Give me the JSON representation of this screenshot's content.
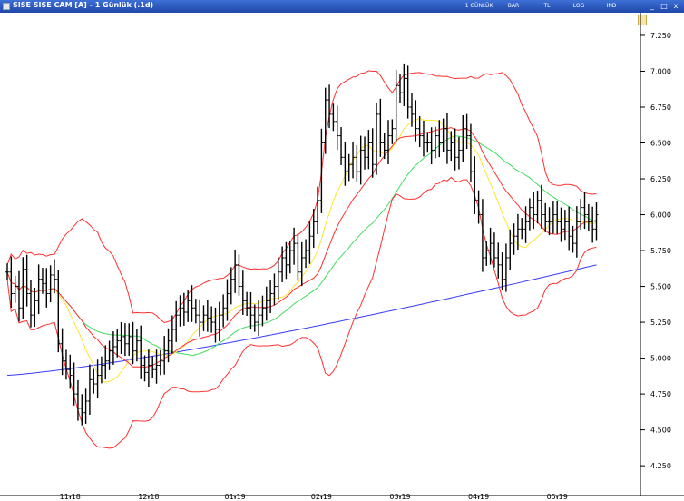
{
  "window": {
    "title": "SISE SISE CAM [A] - 1 Günlük (.1d)",
    "toolbar": [
      "1 GÜNLÜK",
      "BAR",
      "TL",
      "LOG",
      "IND"
    ],
    "controls": [
      "_",
      "□",
      "x"
    ]
  },
  "chart_data": {
    "type": "ohlc",
    "title": "SISE SISE CAM [A] - 1 Günlük (.1d)",
    "y_ticks": [
      4.25,
      4.5,
      4.75,
      5.0,
      5.25,
      5.5,
      5.75,
      6.0,
      6.25,
      6.5,
      6.75,
      7.0,
      7.25
    ],
    "y_tick_labels": [
      "4.250",
      "4.500",
      "4.750",
      "5.000",
      "5.250",
      "5.500",
      "5.750",
      "6.000",
      "6.250",
      "6.500",
      "6.750",
      "7.000",
      "7.250"
    ],
    "ylim": [
      4.08,
      7.37
    ],
    "x_labels": [
      "11-18",
      "12-18",
      "01-19",
      "02-19",
      "03-19",
      "04-19",
      "05-19"
    ],
    "x_label_index": [
      16,
      36,
      58,
      80,
      100,
      120,
      140
    ],
    "n_bars": 147,
    "closes": [
      5.6,
      5.45,
      5.5,
      5.35,
      5.62,
      5.45,
      5.3,
      5.4,
      5.55,
      5.52,
      5.45,
      5.58,
      5.55,
      5.1,
      4.98,
      4.92,
      4.88,
      4.75,
      4.65,
      4.62,
      4.7,
      4.85,
      4.82,
      4.88,
      4.95,
      4.98,
      5.05,
      5.08,
      5.12,
      5.15,
      5.1,
      5.15,
      5.05,
      5.12,
      4.95,
      4.9,
      4.95,
      4.92,
      4.95,
      4.98,
      5.05,
      5.12,
      5.2,
      5.3,
      5.35,
      5.32,
      5.4,
      5.35,
      5.3,
      5.25,
      5.3,
      5.28,
      5.25,
      5.2,
      5.3,
      5.35,
      5.45,
      5.55,
      5.65,
      5.5,
      5.4,
      5.35,
      5.3,
      5.25,
      5.3,
      5.35,
      5.4,
      5.45,
      5.5,
      5.6,
      5.7,
      5.65,
      5.75,
      5.8,
      5.6,
      5.7,
      5.75,
      5.85,
      5.95,
      6.1,
      6.5,
      6.8,
      6.7,
      6.65,
      6.55,
      6.4,
      6.3,
      6.35,
      6.4,
      6.3,
      6.45,
      6.4,
      6.5,
      6.35,
      6.7,
      6.5,
      6.45,
      6.55,
      6.6,
      6.9,
      6.85,
      6.95,
      6.75,
      6.7,
      6.6,
      6.55,
      6.5,
      6.5,
      6.45,
      6.55,
      6.5,
      6.6,
      6.45,
      6.5,
      6.4,
      6.45,
      6.6,
      6.55,
      6.3,
      6.1,
      6.0,
      5.7,
      5.75,
      5.8,
      5.7,
      5.65,
      5.55,
      5.7,
      5.8,
      5.85,
      5.9,
      5.9,
      5.95,
      6.05,
      6.0,
      6.1,
      6.0,
      5.95,
      5.95,
      6.0,
      5.95,
      5.9,
      5.95,
      5.85,
      5.8,
      5.95,
      6.05,
      6.0,
      5.95,
      5.9,
      6.0
    ],
    "series": [
      {
        "kind": "price-bars",
        "color": "#000000"
      },
      {
        "kind": "bollinger-upper",
        "color": "#ff3030"
      },
      {
        "kind": "bollinger-lower",
        "color": "#ff3030"
      },
      {
        "kind": "bollinger-mid",
        "color": "#ff3030"
      },
      {
        "kind": "ma-20",
        "color": "#ffe430"
      },
      {
        "kind": "ma-50",
        "color": "#40dd60"
      },
      {
        "kind": "ma-200",
        "color": "#3a3aff"
      }
    ],
    "grid": false
  }
}
